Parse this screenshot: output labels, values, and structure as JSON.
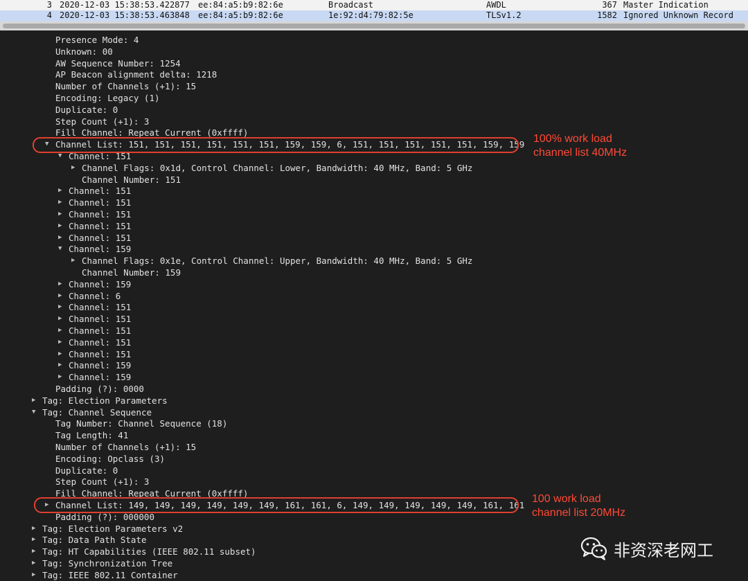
{
  "packet_list": [
    {
      "no": "3",
      "time": "2020-12-03 15:38:53.422877",
      "source": "ee:84:a5:b9:82:6e",
      "destination": "Broadcast",
      "protocol": "AWDL",
      "length": "367",
      "info": "Master Indication"
    },
    {
      "no": "4",
      "time": "2020-12-03 15:38:53.463848",
      "source": "ee:84:a5:b9:82:6e",
      "destination": "1e:92:d4:79:82:5e",
      "protocol": "TLSv1.2",
      "length": "1582",
      "info": "Ignored Unknown Record"
    }
  ],
  "details": [
    {
      "text": "Presence Mode: 4",
      "indent": 4,
      "arrow": ""
    },
    {
      "text": "Unknown: 00",
      "indent": 4,
      "arrow": ""
    },
    {
      "text": "AW Sequence Number: 1254",
      "indent": 4,
      "arrow": ""
    },
    {
      "text": "AP Beacon alignment delta: 1218",
      "indent": 4,
      "arrow": ""
    },
    {
      "text": "Number of Channels (+1): 15",
      "indent": 4,
      "arrow": ""
    },
    {
      "text": "Encoding: Legacy (1)",
      "indent": 4,
      "arrow": ""
    },
    {
      "text": "Duplicate: 0",
      "indent": 4,
      "arrow": ""
    },
    {
      "text": "Step Count (+1): 3",
      "indent": 4,
      "arrow": ""
    },
    {
      "text": "Fill Channel: Repeat Current (0xffff)",
      "indent": 4,
      "arrow": ""
    },
    {
      "text": "Channel List: 151, 151, 151, 151, 151, 151, 159, 159, 6, 151, 151, 151, 151, 151, 159, 159",
      "indent": 4,
      "arrow": "down"
    },
    {
      "text": "Channel: 151",
      "indent": 5,
      "arrow": "down"
    },
    {
      "text": "Channel Flags: 0x1d, Control Channel: Lower, Bandwidth: 40 MHz, Band: 5 GHz",
      "indent": 6,
      "arrow": "right"
    },
    {
      "text": "Channel Number: 151",
      "indent": 6,
      "arrow": ""
    },
    {
      "text": "Channel: 151",
      "indent": 5,
      "arrow": "right"
    },
    {
      "text": "Channel: 151",
      "indent": 5,
      "arrow": "right"
    },
    {
      "text": "Channel: 151",
      "indent": 5,
      "arrow": "right"
    },
    {
      "text": "Channel: 151",
      "indent": 5,
      "arrow": "right"
    },
    {
      "text": "Channel: 151",
      "indent": 5,
      "arrow": "right"
    },
    {
      "text": "Channel: 159",
      "indent": 5,
      "arrow": "down"
    },
    {
      "text": "Channel Flags: 0x1e, Control Channel: Upper, Bandwidth: 40 MHz, Band: 5 GHz",
      "indent": 6,
      "arrow": "right"
    },
    {
      "text": "Channel Number: 159",
      "indent": 6,
      "arrow": ""
    },
    {
      "text": "Channel: 159",
      "indent": 5,
      "arrow": "right"
    },
    {
      "text": "Channel: 6",
      "indent": 5,
      "arrow": "right"
    },
    {
      "text": "Channel: 151",
      "indent": 5,
      "arrow": "right"
    },
    {
      "text": "Channel: 151",
      "indent": 5,
      "arrow": "right"
    },
    {
      "text": "Channel: 151",
      "indent": 5,
      "arrow": "right"
    },
    {
      "text": "Channel: 151",
      "indent": 5,
      "arrow": "right"
    },
    {
      "text": "Channel: 151",
      "indent": 5,
      "arrow": "right"
    },
    {
      "text": "Channel: 159",
      "indent": 5,
      "arrow": "right"
    },
    {
      "text": "Channel: 159",
      "indent": 5,
      "arrow": "right"
    },
    {
      "text": "Padding (?): 0000",
      "indent": 4,
      "arrow": ""
    },
    {
      "text": "Tag: Election Parameters",
      "indent": 3,
      "arrow": "right"
    },
    {
      "text": "Tag: Channel Sequence",
      "indent": 3,
      "arrow": "down"
    },
    {
      "text": "Tag Number: Channel Sequence (18)",
      "indent": 4,
      "arrow": ""
    },
    {
      "text": "Tag Length: 41",
      "indent": 4,
      "arrow": ""
    },
    {
      "text": "Number of Channels (+1): 15",
      "indent": 4,
      "arrow": ""
    },
    {
      "text": "Encoding: Opclass (3)",
      "indent": 4,
      "arrow": ""
    },
    {
      "text": "Duplicate: 0",
      "indent": 4,
      "arrow": ""
    },
    {
      "text": "Step Count (+1): 3",
      "indent": 4,
      "arrow": ""
    },
    {
      "text": "Fill Channel: Repeat Current (0xffff)",
      "indent": 4,
      "arrow": ""
    },
    {
      "text": "Channel List: 149, 149, 149, 149, 149, 149, 161, 161, 6, 149, 149, 149, 149, 149, 161, 161",
      "indent": 4,
      "arrow": "right"
    },
    {
      "text": "Padding (?): 000000",
      "indent": 4,
      "arrow": ""
    },
    {
      "text": "Tag: Election Parameters v2",
      "indent": 3,
      "arrow": "right"
    },
    {
      "text": "Tag: Data Path State",
      "indent": 3,
      "arrow": "right"
    },
    {
      "text": "Tag: HT Capabilities (IEEE 802.11 subset)",
      "indent": 3,
      "arrow": "right"
    },
    {
      "text": "Tag: Synchronization Tree",
      "indent": 3,
      "arrow": "right"
    },
    {
      "text": "Tag: IEEE 802.11 Container",
      "indent": 3,
      "arrow": "right"
    }
  ],
  "annotations": {
    "note1_line1": "100% work load",
    "note1_line2": "channel list 40MHz",
    "note2_line1": "100 work load",
    "note2_line2": "channel list 20MHz",
    "color": "#e0402e"
  },
  "watermark": {
    "icon": "wechat-icon",
    "text": "非资深老网工"
  },
  "icons": {
    "expanded": "triangle-down-icon",
    "collapsed": "triangle-right-icon"
  }
}
